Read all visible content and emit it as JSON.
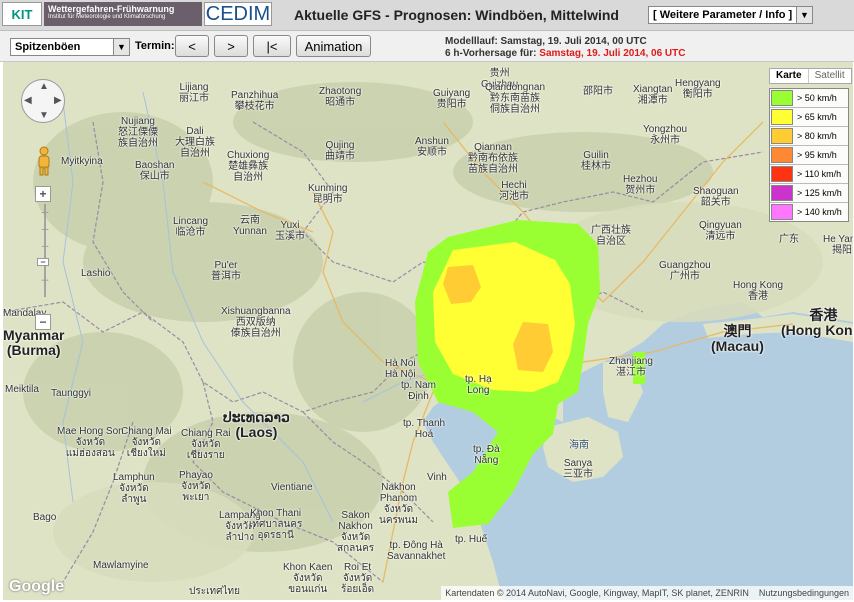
{
  "header": {
    "kit_logo": "KIT",
    "warn_logo_title": "Wettergefahren-Frühwarnung",
    "warn_logo_subtitle": "Institut für Meteorologie und Klimaforschung",
    "cedim_logo": "CEDIM",
    "title": "Aktuelle GFS - Prognosen: Windböen, Mittelwind",
    "param_select": "[ Weitere Parameter / Info ]"
  },
  "toolbar": {
    "variable_select": "Spitzenböen",
    "termin_label": "Termin:",
    "prev_label": "<",
    "next_label": ">",
    "first_label": "|<",
    "animation_label": "Animation",
    "model_run_label": "Modelllauf: Samstag, 19. Juli 2014, 00 UTC",
    "forecast_prefix": "6 h-Vorhersage für:",
    "forecast_time": "Samstag, 19. Juli 2014, 06 UTC"
  },
  "map": {
    "maptype_map": "Karte",
    "maptype_sat": "Satellit",
    "zoom_in": "+",
    "zoom_out": "−",
    "attribution": "Kartendaten © 2014 AutoNavi, Google, Kingway, MapIT, SK planet, ZENRIN",
    "terms": "Nutzungsbedingungen",
    "google_logo": "Google",
    "places": {
      "myanmar": "Myanmar\n(Burma)",
      "laos": "ປະເທດລາວ\n(Laos)",
      "guizhou": "贵州\nGuizhou",
      "guangxi": "广西壮族\n自治区",
      "yunnan": "云南\nYunnan",
      "hunan": "Hengyang\n衡阳市",
      "kunming": "Kunming\n昆明市",
      "guiyang": "Guiyang\n贵阳市",
      "qiandongnan": "Qiandongnan\n黔东南苗族\n侗族自治州",
      "qiannan": "Qiannan\n黔南布依族\n苗族自治州",
      "anshun": "Anshun\n安顺市",
      "hechi": "Hechi\n河池市",
      "lijiang": "Lijiang\n丽江市",
      "panzhihua": "Panzhihua\n攀枝花市",
      "zhaotong": "Zhaotong\n昭通市",
      "dali": "Dali\n大理白族\n自治州",
      "chuxiong": "Chuxiong\n楚雄彝族\n自治州",
      "qujing": "Qujing\n曲靖市",
      "baoshan": "Baoshan\n保山市",
      "lincang": "Lincang\n临沧市",
      "yuxi": "Yuxi\n玉溪市",
      "puer": "Pu'er\n普洱市",
      "xishuangbanna": "Xishuangbanna\n西双版纳\n傣族自治州",
      "nujiang": "Nujiang\n怒江傈僳\n族自治州",
      "myitkyina": "Myitkyina",
      "lashio": "Lashio",
      "mandalay": "Mandalay",
      "meiktila": "Meiktila",
      "taunggyi": "Taunggyi",
      "bago": "Bago",
      "mawlamyine": "Mawlamyine",
      "hanoi": "Hà Noi\nHà Nội",
      "namdinh": "tp. Nam\nĐịnh",
      "thanhhoa": "tp. Thanh\nHoá",
      "vinh": "Vinh",
      "vientiane": "Vientiane",
      "chiangmai": "Chiang Mai\nจังหวัด\nเชียงใหม่",
      "chiangrai": "Chiang Rai\nจังหวัด\nเชียงราย",
      "maehongson": "Mae Hong Son\nจังหวัด\nแม่ฮ่องสอน",
      "phayao": "Phayao\nจังหวัด\nพะเยา",
      "lamphun": "Lamphun\nจังหวัด\nลำพูน",
      "lampang": "Lampang\nจังหวัด\nลำปาง",
      "khonthani": "Khon Thani\nเทศบาลนคร\nอุดรธานี",
      "khonkaen": "Khon Kaen\nจังหวัด\nขอนแก่น",
      "sakon": "Sakon\nNakhon\nจังหวัด\nสกลนคร",
      "nakhon": "Nakhon\nPhanom\nจังหวัด\nนครพนม",
      "roiet": "Roi Et\nจังหวัด\nร้อยเอ็ด",
      "savannakhet": "tp. Đông Hà\nSavannakhet",
      "hue": "tp. Huế",
      "laos_thai": "ประเทศไทย",
      "zhanjiang": "Zhanjiang\n湛江市",
      "hainan": "海南",
      "sanya": "Sanya\n三亚市",
      "guangzhou": "Guangzhou\n广州市",
      "hongkong_en": "Hong Kong\n香港",
      "hongkong_zh": "香港\n(Hong Kong)",
      "macau": "澳門\n(Macau)",
      "guangdong": "广东",
      "shaoguan": "Shaoguan\n韶关市",
      "qingyuan": "Qingyuan\n清远市",
      "yongzhou": "Yongzhou\n永州市",
      "hezhou": "Hezhou\n贺州市",
      "guilin": "Guilin\n桂林市",
      "xiangtan": "Xiangtan\n湘潭市",
      "hegang": "He Yang\n揭阳",
      "shaoyang": "邵阳市",
      "tp_hue2": "tp. Đà\nNẵng",
      "tp_hai": "tp. Hạ\nLong"
    }
  },
  "legend": [
    {
      "label": "> 50 km/h",
      "color": "#99ff33"
    },
    {
      "label": "> 65 km/h",
      "color": "#ffff33"
    },
    {
      "label": "> 80 km/h",
      "color": "#ffcc33"
    },
    {
      "label": "> 95 km/h",
      "color": "#ff8833"
    },
    {
      "label": "> 110 km/h",
      "color": "#ff3311"
    },
    {
      "label": "> 125 km/h",
      "color": "#cc33cc"
    },
    {
      "label": "> 140 km/h",
      "color": "#ff77ff"
    }
  ]
}
